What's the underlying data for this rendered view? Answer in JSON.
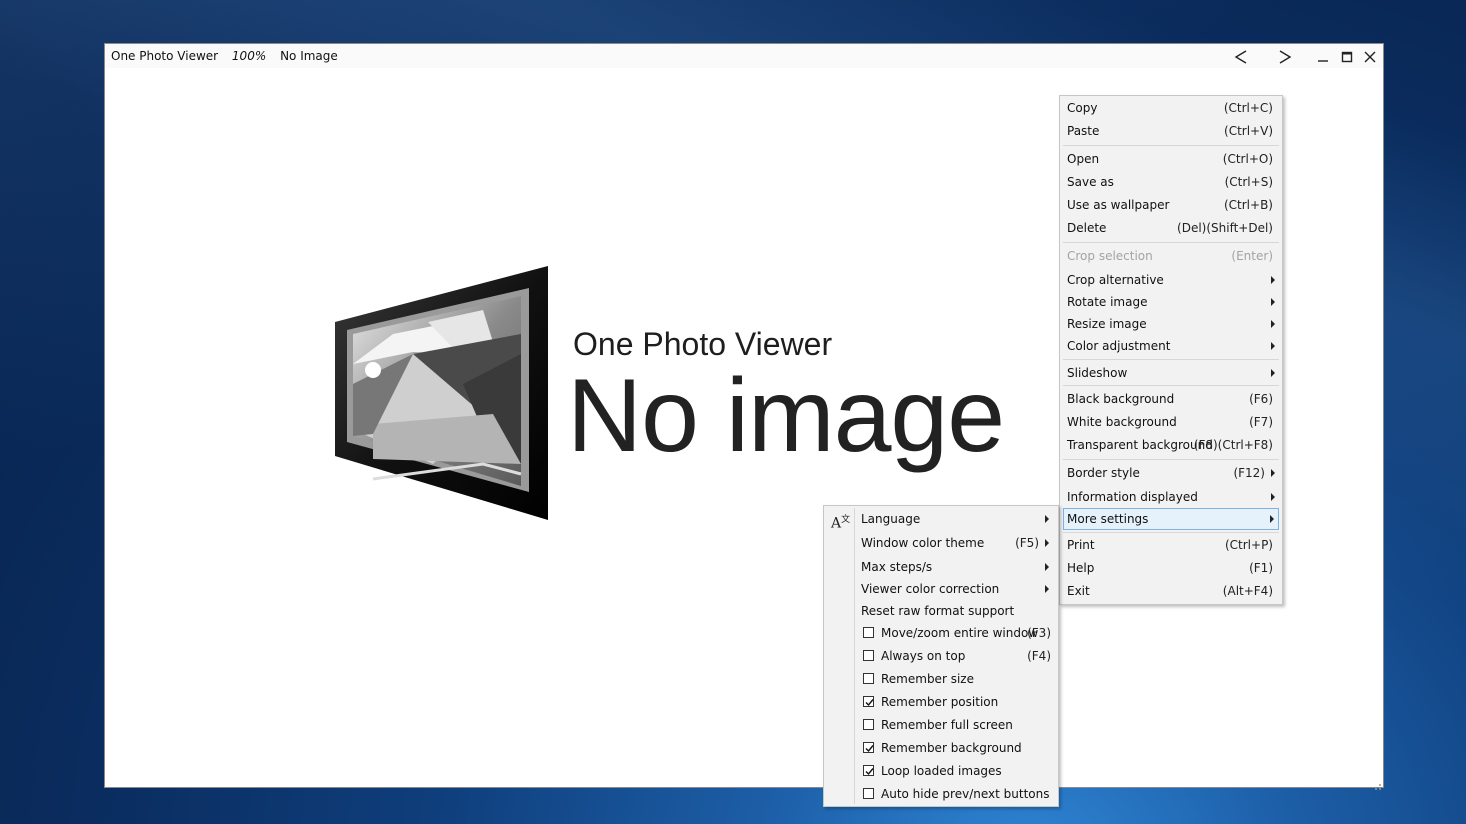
{
  "window": {
    "app_name": "One Photo Viewer",
    "zoom": "100%",
    "file_label": "No Image"
  },
  "placeholder": {
    "title": "One Photo Viewer",
    "message": "No image"
  },
  "main_menu": {
    "items": [
      {
        "label": "Copy",
        "shortcut": "(Ctrl+C)"
      },
      {
        "label": "Paste",
        "shortcut": "(Ctrl+V)"
      },
      {
        "label": "Open",
        "shortcut": "(Ctrl+O)"
      },
      {
        "label": "Save as",
        "shortcut": "(Ctrl+S)"
      },
      {
        "label": "Use as wallpaper",
        "shortcut": "(Ctrl+B)"
      },
      {
        "label": "Delete",
        "shortcut": "(Del)(Shift+Del)"
      },
      {
        "label": "Crop selection",
        "shortcut": "(Enter)",
        "disabled": true
      },
      {
        "label": "Crop alternative",
        "submenu": true
      },
      {
        "label": "Rotate image",
        "submenu": true
      },
      {
        "label": "Resize image",
        "submenu": true
      },
      {
        "label": "Color adjustment",
        "submenu": true
      },
      {
        "label": "Slideshow",
        "submenu": true
      },
      {
        "label": "Black background",
        "shortcut": "(F6)"
      },
      {
        "label": "White background",
        "shortcut": "(F7)"
      },
      {
        "label": "Transparent background",
        "shortcut": "(F8)(Ctrl+F8)"
      },
      {
        "label": "Border style",
        "shortcut": "(F12)",
        "submenu": true
      },
      {
        "label": "Information displayed",
        "submenu": true
      },
      {
        "label": "More settings",
        "submenu": true,
        "highlighted": true
      },
      {
        "label": "Print",
        "shortcut": "(Ctrl+P)"
      },
      {
        "label": "Help",
        "shortcut": "(F1)"
      },
      {
        "label": "Exit",
        "shortcut": "(Alt+F4)"
      }
    ]
  },
  "more_settings_menu": {
    "language_icon": "translate-icon",
    "items": [
      {
        "label": "Language",
        "submenu": true
      },
      {
        "label": "Window color theme",
        "shortcut": "(F5)",
        "submenu": true
      },
      {
        "label": "Max steps/s",
        "submenu": true
      },
      {
        "label": "Viewer color correction",
        "submenu": true
      },
      {
        "label": "Reset raw format support"
      },
      {
        "label": "Move/zoom entire window",
        "shortcut": "(F3)",
        "checked": false
      },
      {
        "label": "Always on top",
        "shortcut": "(F4)",
        "checked": false
      },
      {
        "label": "Remember size",
        "checked": false
      },
      {
        "label": "Remember position",
        "checked": true
      },
      {
        "label": "Remember full screen",
        "checked": false
      },
      {
        "label": "Remember background",
        "checked": true
      },
      {
        "label": "Loop loaded images",
        "checked": true
      },
      {
        "label": "Auto hide prev/next buttons",
        "checked": false
      }
    ]
  }
}
